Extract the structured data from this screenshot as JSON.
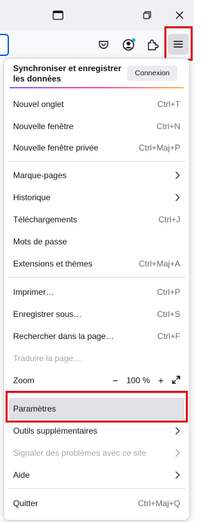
{
  "menu": {
    "sync": {
      "title": "Synchroniser et enregistrer les données",
      "button": "Connexion"
    },
    "items": [
      {
        "label": "Nouvel onglet",
        "shortcut": "Ctrl+T"
      },
      {
        "label": "Nouvelle fenêtre",
        "shortcut": "Ctrl+N"
      },
      {
        "label": "Nouvelle fenêtre privée",
        "shortcut": "Ctrl+Maj+P"
      },
      {
        "label": "Marque-pages"
      },
      {
        "label": "Historique"
      },
      {
        "label": "Téléchargements",
        "shortcut": "Ctrl+J"
      },
      {
        "label": "Mots de passe"
      },
      {
        "label": "Extensions et thèmes",
        "shortcut": "Ctrl+Maj+A"
      },
      {
        "label": "Imprimer…",
        "shortcut": "Ctrl+P"
      },
      {
        "label": "Enregistrer sous…",
        "shortcut": "Ctrl+S"
      },
      {
        "label": "Rechercher dans la page…",
        "shortcut": "Ctrl+F"
      },
      {
        "label": "Traduire la page…"
      },
      {
        "label": "Zoom"
      },
      {
        "label": "Paramètres"
      },
      {
        "label": "Outils supplémentaires"
      },
      {
        "label": "Signaler des problèmes avec ce site"
      },
      {
        "label": "Aide"
      },
      {
        "label": "Quitter",
        "shortcut": "Ctrl+Maj+Q"
      }
    ],
    "zoom": {
      "minus": "−",
      "level": "100 %",
      "plus": "+"
    }
  },
  "colors": {
    "highlight": "#e0141e",
    "accent": "#0061e0",
    "badge": "#00b3f4",
    "selected_row": "#e0e0e6"
  },
  "icons": {
    "window": "window-icon",
    "restore": "restore-icon",
    "close": "close-icon",
    "pocket": "pocket-icon",
    "account": "account-icon",
    "extensions": "extensions-icon",
    "menu": "hamburger-menu-icon",
    "chevron": "chevron-right-icon",
    "fullscreen": "fullscreen-icon"
  }
}
